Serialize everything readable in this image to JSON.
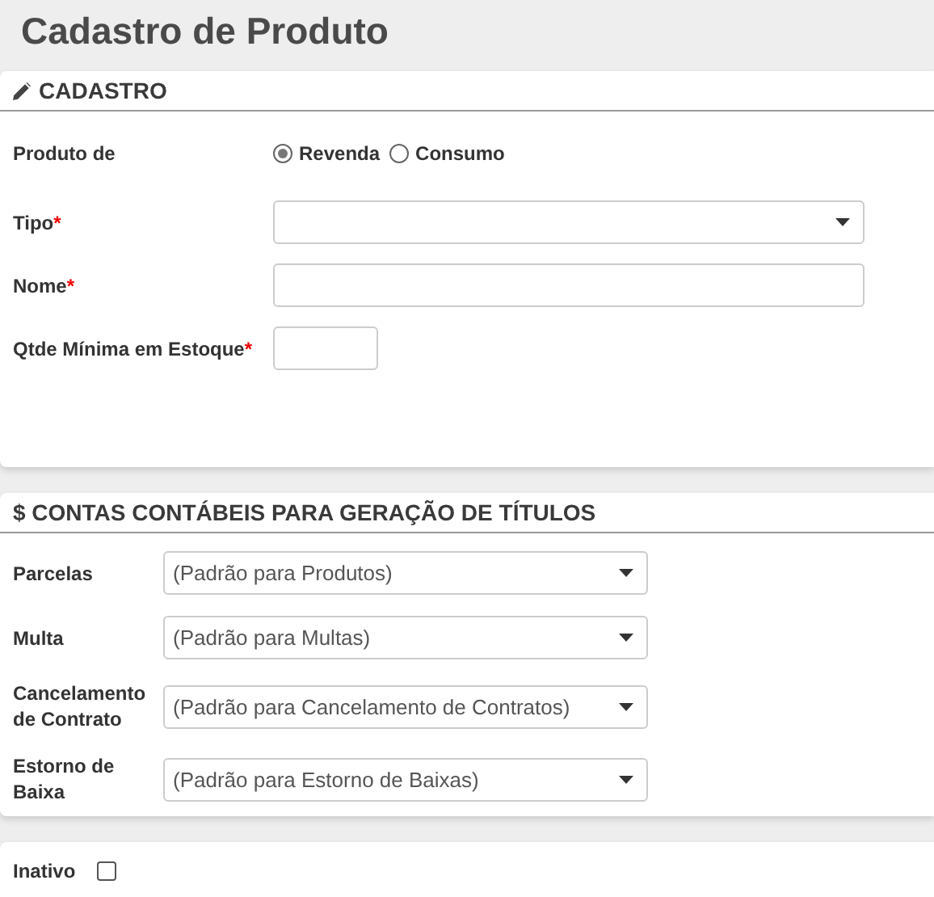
{
  "page_title": "Cadastro de Produto",
  "cadastro": {
    "title": "CADASTRO",
    "produto_de": {
      "label": "Produto de",
      "options": [
        {
          "label": "Revenda",
          "selected": true
        },
        {
          "label": "Consumo",
          "selected": false
        }
      ]
    },
    "fields": [
      {
        "kind": "select",
        "label": "Tipo",
        "required_mark": "*"
      },
      {
        "kind": "text",
        "label": "Nome",
        "required_mark": "*"
      },
      {
        "kind": "short",
        "label": "Qtde Mínima em Estoque",
        "required_mark": "*"
      }
    ]
  },
  "contas": {
    "title": "$ CONTAS CONTÁBEIS PARA GERAÇÃO DE TÍTULOS",
    "fields": [
      {
        "label": "Parcelas",
        "value": "(Padrão para Produtos)"
      },
      {
        "label": "Multa",
        "value": "(Padrão para Multas)"
      },
      {
        "label": "Cancelamento de Contrato",
        "value": "(Padrão para Cancelamento de Contratos)"
      },
      {
        "label": "Estorno de Baixa",
        "value": "(Padrão para Estorno de Baixas)"
      }
    ]
  },
  "inativo": {
    "label": "Inativo",
    "checked": false
  }
}
